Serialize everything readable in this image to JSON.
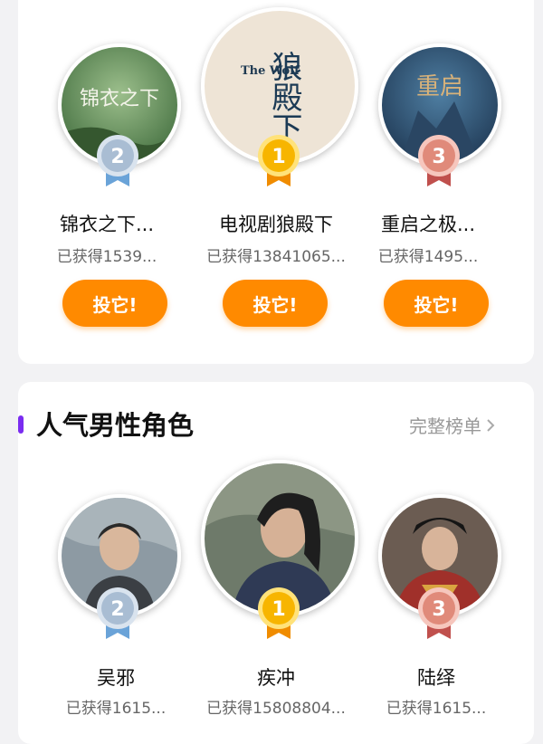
{
  "section1": {
    "items": [
      {
        "rank": "2",
        "name": "锦衣之下...",
        "count": "已获得1539...",
        "button": "投它!",
        "poster_text": "锦衣之下"
      },
      {
        "rank": "1",
        "name": "电视剧狼殿下",
        "count": "已获得13841065...",
        "button": "投它!",
        "poster_text": "狼殿下",
        "poster_text_en": "The Wolf"
      },
      {
        "rank": "3",
        "name": "重启之极...",
        "count": "已获得1495...",
        "button": "投它!",
        "poster_text": "重启"
      }
    ]
  },
  "section2": {
    "title": "人气男性角色",
    "full_list": "完整榜单",
    "items": [
      {
        "rank": "2",
        "name": "吴邪",
        "count": "已获得1615..."
      },
      {
        "rank": "1",
        "name": "疾冲",
        "count": "已获得15808804..."
      },
      {
        "rank": "3",
        "name": "陆绎",
        "count": "已获得1615..."
      }
    ]
  },
  "colors": {
    "accent": "#ff8a00",
    "section_bar": "#7a2cf0",
    "gold": "#f7b500",
    "silver": "#a9bdd3",
    "bronze": "#e08a7a"
  },
  "icons": {
    "rank1": "gold-medal-icon",
    "rank2": "silver-medal-icon",
    "rank3": "bronze-medal-icon",
    "chevron": "chevron-right-icon"
  }
}
